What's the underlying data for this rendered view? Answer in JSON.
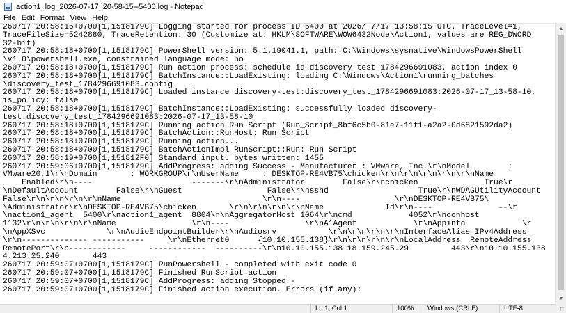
{
  "window": {
    "title": "action1_log_2026-07-17_20-58-15--5400.log - Notepad",
    "app_icon": "notepad-icon"
  },
  "menu": [
    "File",
    "Edit",
    "Format",
    "View",
    "Help"
  ],
  "editor": {
    "lines": [
      "260717 20:58:15+0700[1,1518179C] Logging started for process ID 5400 at 2026/ 7/17 13:58:15 UTC. TraceLevel=1,",
      "TraceFileSize=5242880, TraceRetention: 30 (Customize at: HKLM\\SOFTWARE\\WOW6432Node\\Action1, values are REG_DWORD",
      "32-bit)",
      "260717 20:58:18+0700[1,1518179C] PowerShell version: 5.1.19041.1, path: C:\\Windows\\sysnative\\WindowsPowerShell",
      "\\v1.0\\powershell.exe, constrained language mode: no",
      "260717 20:58:18+0700[1,1518179C] Run action process: schedule id discovery_test_1784296691083, action index 0",
      "260717 20:58:18+0700[1,1518179C] BatchInstance::LoadExisting: loading C:\\Windows\\Action1\\running_batches",
      "\\discovery_test_1784296691083.config",
      "260717 20:58:18+0700[1,1518179C] Loaded instance discovery-test:discovery_test_1784296691083:2026-07-17_13-58-10,",
      "is_policy: false",
      "260717 20:58:18+0700[1,1518179C] BatchInstance::LoadExisting: successfully loaded discovery-",
      "test:discovery_test_1784296691083:2026-07-17_13-58-10",
      "260717 20:58:18+0700[1,1518179C] Running action Run Script (Run_Script_8bf6c5b0-81e7-11f1-a2a2-0d6821592da2)",
      "260717 20:58:18+0700[1,1518179C] BatchAction::RunHost: Run Script",
      "260717 20:58:18+0700[1,1518179C] Running action...",
      "260717 20:58:18+0700[1,1518179C] BatchActionImpl_RunScript::Run: Run Script",
      "260717 20:58:19+0700[1,151812F0] Standard input. bytes written: 1455",
      "260717 20:59:06+0700[1,1518179C] AddProgress: adding Success - Manufacturer : VMware, Inc.\\r\\nModel        :",
      "VMware20,1\\r\\nDomain       : WORKGROUP\\r\\nUserName     : DESKTOP-RE4VB75\\chicken\\r\\n\\r\\n\\r\\n\\r\\n\\r\\nName",
      "    Enabled\\r\\n----                     -------\\r\\nAdministrator        False\\r\\nchicken              True\\r",
      "\\nDefaultAccount        False\\r\\nGuest                  False\\r\\nsshd                   True\\r\\nWDAGUtilityAccount",
      "False\\r\\n\\r\\n\\r\\n\\r\\nName                              \\r\\n----                    \\r\\nDESKTOP-RE4VB75\\",
      "\\Administrator\\r\\nDESKTOP-RE4VB75\\chicken       \\r\\n\\r\\n\\r\\n\\r\\nName             Id\\r\\n----              --\\r",
      "\\naction1_agent  5400\\r\\naction1_agent  8804\\r\\nAggregatorHost 1064\\r\\ncmd            4052\\r\\nconhost",
      "1132\\r\\n\\r\\n\\r\\n\\r\\nName                \\r\\n----                \\r\\nA1Agent            \\r\\nAppinfo            \\r",
      "\\nAppXSvc             \\r\\nAudioEndpointBuilder\\r\\nAudiosrv           \\r\\n\\r\\n\\r\\n\\r\\nInterfaceAlias IPv4Address",
      "\\r\\n-------------- -----------     \\r\\nEthernet0      {10.10.155.138}\\r\\n\\r\\n\\r\\n\\r\\nLocalAddress  RemoteAddress",
      "RemotePort\\r\\n------------     ------------  ----------\\r\\n10.10.155.138 18.159.245.29         443\\r\\n10.10.155.138",
      "4.213.25.240       443",
      "260717 20:59:07+0700[1,1518179C] RunPowershell - completed with exit code 0",
      "260717 20:59:07+0700[1,1518179C] Finished RunScript action",
      "260717 20:59:07+0700[1,1518179C] AddProgress: adding Stopped -",
      "260717 20:59:07+0700[1,1518179C] Finished action execution. Errors (if any):"
    ]
  },
  "statusbar": {
    "position": "Ln 1, Col 1",
    "zoom": "100%",
    "line_ending": "Windows (CRLF)",
    "encoding": "UTF-8"
  },
  "icons": {
    "scroll_up": "scroll-up-arrow-icon",
    "scroll_down": "scroll-down-arrow-icon",
    "size_grip": "size-grip-icon"
  }
}
